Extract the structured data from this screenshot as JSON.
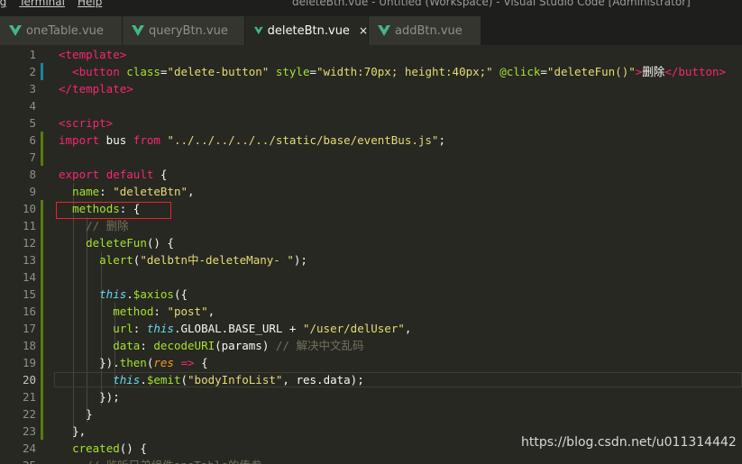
{
  "window": {
    "menu": [
      "ug",
      "Terminal",
      "Help"
    ],
    "title": "deleteBtn.vue - Untitled (Workspace) - Visual Studio Code [Administrator]"
  },
  "tabs": [
    {
      "label": "oneTable.vue",
      "active": false
    },
    {
      "label": "queryBtn.vue",
      "active": false
    },
    {
      "label": "deleteBtn.vue",
      "active": true,
      "close": "×"
    },
    {
      "label": "addBtn.vue",
      "active": false
    }
  ],
  "colors": {
    "vue_icon": "#41b883",
    "modified_gutter": "#587c0c",
    "added_gutter": "#4a7c2a",
    "highlight_box": "#e8262d"
  },
  "editor": {
    "current_line": 20,
    "lines": [
      {
        "n": "1",
        "tokens": [
          [
            "t-tag",
            "<template>"
          ]
        ]
      },
      {
        "n": "2",
        "tokens": [
          [
            "t-tag",
            "  <button "
          ],
          [
            "t-attr",
            "class"
          ],
          [
            "t-pun",
            "="
          ],
          [
            "t-str",
            "\"delete-button\""
          ],
          [
            "t-pl",
            " "
          ],
          [
            "t-attr",
            "style"
          ],
          [
            "t-pun",
            "="
          ],
          [
            "t-str",
            "\"width:70px; height:40px;\""
          ],
          [
            "t-pl",
            " "
          ],
          [
            "t-attr",
            "@click"
          ],
          [
            "t-pun",
            "="
          ],
          [
            "t-str",
            "\"deleteFun()\""
          ],
          [
            "t-tag",
            ">"
          ],
          [
            "t-zh",
            "删除"
          ],
          [
            "t-tag",
            "</button>"
          ]
        ]
      },
      {
        "n": "3",
        "tokens": [
          [
            "t-tag",
            "</template>"
          ]
        ]
      },
      {
        "n": "4",
        "tokens": []
      },
      {
        "n": "5",
        "tokens": [
          [
            "t-tag",
            "<script>"
          ]
        ]
      },
      {
        "n": "6",
        "tokens": [
          [
            "t-kw",
            "import"
          ],
          [
            "t-pl",
            " bus "
          ],
          [
            "t-kw",
            "from"
          ],
          [
            "t-pl",
            " "
          ],
          [
            "t-str",
            "\"../../../../../static/base/eventBus.js\""
          ],
          [
            "t-pun",
            ";"
          ]
        ]
      },
      {
        "n": "7",
        "tokens": []
      },
      {
        "n": "8",
        "tokens": [
          [
            "t-kw",
            "export"
          ],
          [
            "t-pl",
            " "
          ],
          [
            "t-kw",
            "default"
          ],
          [
            "t-pl",
            " {"
          ]
        ]
      },
      {
        "n": "9",
        "tokens": [
          [
            "t-pl",
            "  "
          ],
          [
            "t-key",
            "name"
          ],
          [
            "t-pun",
            ": "
          ],
          [
            "t-str",
            "\"deleteBtn\""
          ],
          [
            "t-pun",
            ","
          ]
        ]
      },
      {
        "n": "10",
        "tokens": [
          [
            "t-pl",
            "  "
          ],
          [
            "t-key",
            "methods"
          ],
          [
            "t-pun",
            ": {"
          ]
        ]
      },
      {
        "n": "11",
        "tokens": [
          [
            "t-pl",
            "    "
          ],
          [
            "t-com",
            "// 删除"
          ]
        ]
      },
      {
        "n": "12",
        "tokens": [
          [
            "t-pl",
            "    "
          ],
          [
            "t-fn",
            "deleteFun"
          ],
          [
            "t-pun",
            "() {"
          ]
        ]
      },
      {
        "n": "13",
        "tokens": [
          [
            "t-pl",
            "      "
          ],
          [
            "t-fn",
            "alert"
          ],
          [
            "t-pun",
            "("
          ],
          [
            "t-str",
            "\"delbtn中-deleteMany- \""
          ],
          [
            "t-pun",
            ");"
          ]
        ]
      },
      {
        "n": "14",
        "tokens": []
      },
      {
        "n": "15",
        "tokens": [
          [
            "t-pl",
            "      "
          ],
          [
            "t-this",
            "this"
          ],
          [
            "t-pun",
            "."
          ],
          [
            "t-fn",
            "$axios"
          ],
          [
            "t-pun",
            "({"
          ]
        ]
      },
      {
        "n": "16",
        "tokens": [
          [
            "t-pl",
            "        "
          ],
          [
            "t-key",
            "method"
          ],
          [
            "t-pun",
            ": "
          ],
          [
            "t-str",
            "\"post\""
          ],
          [
            "t-pun",
            ","
          ]
        ]
      },
      {
        "n": "17",
        "tokens": [
          [
            "t-pl",
            "        "
          ],
          [
            "t-key",
            "url"
          ],
          [
            "t-pun",
            ": "
          ],
          [
            "t-this",
            "this"
          ],
          [
            "t-pun",
            "."
          ],
          [
            "t-pl",
            "GLOBAL"
          ],
          [
            "t-pun",
            "."
          ],
          [
            "t-pl",
            "BASE_URL"
          ],
          [
            "t-pun",
            " + "
          ],
          [
            "t-str",
            "\"/user/delUser\""
          ],
          [
            "t-pun",
            ","
          ]
        ]
      },
      {
        "n": "18",
        "tokens": [
          [
            "t-pl",
            "        "
          ],
          [
            "t-key",
            "data"
          ],
          [
            "t-pun",
            ": "
          ],
          [
            "t-fn",
            "decodeURI"
          ],
          [
            "t-pun",
            "("
          ],
          [
            "t-pl",
            "params"
          ],
          [
            "t-pun",
            ") "
          ],
          [
            "t-com",
            "// 解决中文乱码"
          ]
        ]
      },
      {
        "n": "19",
        "tokens": [
          [
            "t-pl",
            "      "
          ],
          [
            "t-pun",
            "})."
          ],
          [
            "t-fn",
            "then"
          ],
          [
            "t-pun",
            "("
          ],
          [
            "t-par",
            "res"
          ],
          [
            "t-pun",
            " "
          ],
          [
            "t-kw",
            "=>"
          ],
          [
            "t-pun",
            " {"
          ]
        ]
      },
      {
        "n": "20",
        "tokens": [
          [
            "t-pl",
            "        "
          ],
          [
            "t-this",
            "this"
          ],
          [
            "t-pun",
            "."
          ],
          [
            "t-fn",
            "$emit"
          ],
          [
            "t-pun",
            "("
          ],
          [
            "t-str",
            "\"bodyInfoList\""
          ],
          [
            "t-pun",
            ", "
          ],
          [
            "t-pl",
            "res"
          ],
          [
            "t-pun",
            "."
          ],
          [
            "t-pl",
            "data"
          ],
          [
            "t-pun",
            ");"
          ]
        ]
      },
      {
        "n": "21",
        "tokens": [
          [
            "t-pl",
            "      "
          ],
          [
            "t-pun",
            "});"
          ]
        ]
      },
      {
        "n": "22",
        "tokens": [
          [
            "t-pl",
            "    "
          ],
          [
            "t-pun",
            "}"
          ]
        ]
      },
      {
        "n": "23",
        "tokens": [
          [
            "t-pl",
            "  "
          ],
          [
            "t-pun",
            "},"
          ]
        ]
      },
      {
        "n": "24",
        "tokens": [
          [
            "t-pl",
            "  "
          ],
          [
            "t-fn",
            "created"
          ],
          [
            "t-pun",
            "() {"
          ]
        ]
      },
      {
        "n": "25",
        "tokens": [
          [
            "t-pl",
            "    "
          ],
          [
            "t-com",
            "// 监听兄弟组件oneTable的传参"
          ]
        ]
      }
    ]
  },
  "watermark": "https://blog.csdn.net/u011314442"
}
